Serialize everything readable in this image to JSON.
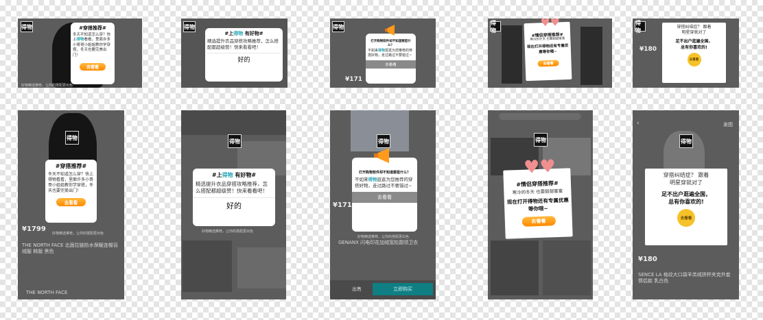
{
  "logo": "得物",
  "footer_note": "好物精选推荐，让你的搭配更出色",
  "p1": {
    "title": "#穿搭推荐#",
    "body_a": "冬天不知道怎么穿？快上",
    "brand": "得物",
    "body_b": "看看，里面许多小哥哥小姐姐教你学穿搭，冬天也要完美出门！",
    "btn": "去看看"
  },
  "p1s": {
    "body": "冬天不知道怎么穿？快上得物看看，里面许多小哥哥小姐姐教你学穿搭，冬天也要完美出门！",
    "price": "¥1799",
    "product": "THE NORTH FACE 北面拉链防水保暖连帽羽绒服 韩版 黑色",
    "foot": "THE NORTH FACE"
  },
  "p2": {
    "title_a": "#上",
    "brand": "得物",
    "title_b": " 有好物#",
    "body": "精选提升衣品穿搭攻略推荐，怎么搭配都超级赞！快来看看吧！",
    "btn": "好的"
  },
  "p3": {
    "title": "打开购物软件却不知道要逛什么？",
    "body_a": "不如来",
    "brand": "得物",
    "body_b": "逛逛为您推荐的穿搭好物，走过路过不要错过~",
    "btn": "去看看",
    "price": "¥171",
    "product": "GENANX 闪电印花加绒宽松圆领卫衣",
    "tab": "出售",
    "buy": "立即购买"
  },
  "p4": {
    "title": "#情侣穿搭推荐#",
    "body": "寒冷的冬天 也要甜甜蜜蜜",
    "hl": "现在打开得物还有专属优惠等你哦~",
    "btn": "去看看"
  },
  "p5": {
    "title_a": "穿搭纠结症？ 跟着",
    "title_b": "明星穿就对了",
    "hl_a": "足不出户逛遍全国，",
    "hl_b": "总有你喜欢的!",
    "btn": "去看看",
    "price": "¥180",
    "product": "SENCE LA 格纹大口袋羊羔绒拼杯夹克外套 情侣款 乳白色",
    "nav": "发图"
  }
}
